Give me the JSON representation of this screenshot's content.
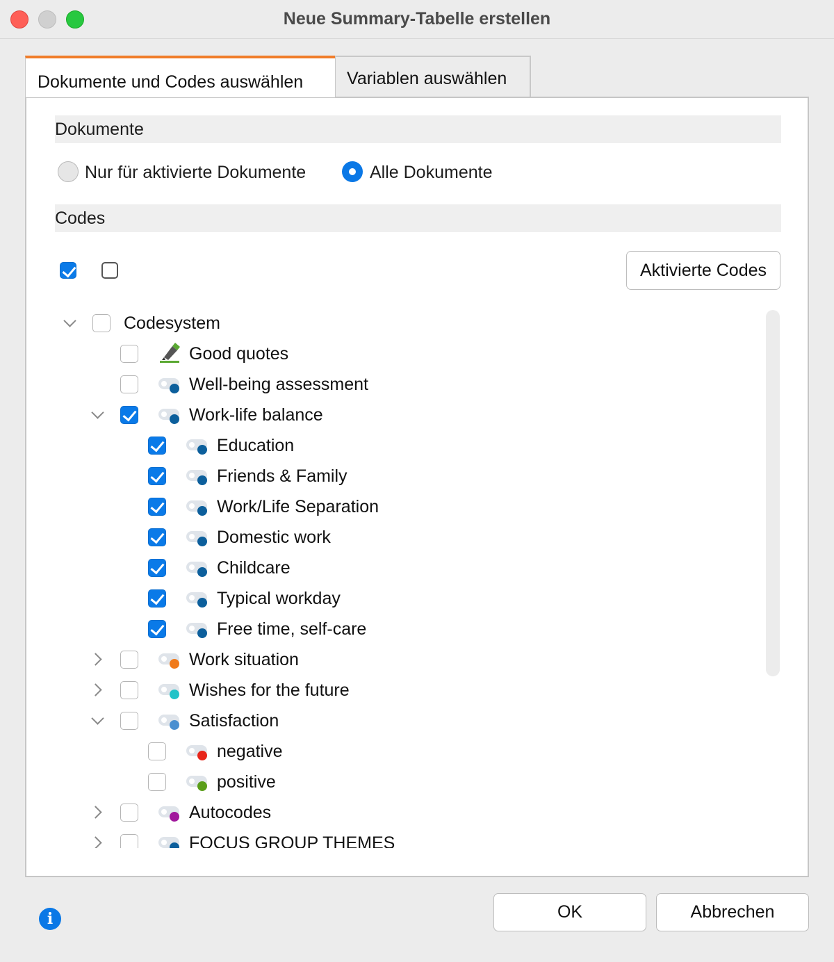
{
  "window": {
    "title": "Neue Summary-Tabelle erstellen"
  },
  "tabs": [
    {
      "label": "Dokumente und Codes auswählen",
      "active": true
    },
    {
      "label": "Variablen auswählen",
      "active": false
    }
  ],
  "documents": {
    "heading": "Dokumente",
    "options": [
      {
        "label": "Nur für aktivierte Dokumente",
        "selected": false
      },
      {
        "label": "Alle Dokumente",
        "selected": true
      }
    ]
  },
  "codes": {
    "heading": "Codes",
    "activated_button": "Aktivierte Codes"
  },
  "tree": [
    {
      "label": "Codesystem",
      "level": 0,
      "expander": "down",
      "checked": false,
      "icon": "none",
      "color": ""
    },
    {
      "label": "Good quotes",
      "level": 1,
      "expander": "none",
      "checked": false,
      "icon": "highlighter-icon",
      "color": "#5aa832"
    },
    {
      "label": "Well-being assessment",
      "level": 1,
      "expander": "none",
      "checked": false,
      "icon": "code-icon",
      "color": "#0c5f9c"
    },
    {
      "label": "Work-life balance",
      "level": 1,
      "expander": "down",
      "checked": true,
      "icon": "code-icon",
      "color": "#0c5f9c"
    },
    {
      "label": "Education",
      "level": 2,
      "expander": "none",
      "checked": true,
      "icon": "code-icon",
      "color": "#0c5f9c"
    },
    {
      "label": "Friends & Family",
      "level": 2,
      "expander": "none",
      "checked": true,
      "icon": "code-icon",
      "color": "#0c5f9c"
    },
    {
      "label": "Work/Life Separation",
      "level": 2,
      "expander": "none",
      "checked": true,
      "icon": "code-icon",
      "color": "#0c5f9c"
    },
    {
      "label": "Domestic work",
      "level": 2,
      "expander": "none",
      "checked": true,
      "icon": "code-icon",
      "color": "#0c5f9c"
    },
    {
      "label": "Childcare",
      "level": 2,
      "expander": "none",
      "checked": true,
      "icon": "code-icon",
      "color": "#0c5f9c"
    },
    {
      "label": "Typical workday",
      "level": 2,
      "expander": "none",
      "checked": true,
      "icon": "code-icon",
      "color": "#0c5f9c"
    },
    {
      "label": "Free time, self-care",
      "level": 2,
      "expander": "none",
      "checked": true,
      "icon": "code-icon",
      "color": "#0c5f9c"
    },
    {
      "label": "Work situation",
      "level": 1,
      "expander": "right",
      "checked": false,
      "icon": "code-icon",
      "color": "#f07a1a"
    },
    {
      "label": "Wishes for the future",
      "level": 1,
      "expander": "right",
      "checked": false,
      "icon": "code-icon",
      "color": "#22c3c8"
    },
    {
      "label": "Satisfaction",
      "level": 1,
      "expander": "down",
      "checked": false,
      "icon": "code-icon",
      "color": "#4a8fd0"
    },
    {
      "label": "negative",
      "level": 2,
      "expander": "none",
      "checked": false,
      "icon": "code-icon",
      "color": "#e8261a"
    },
    {
      "label": "positive",
      "level": 2,
      "expander": "none",
      "checked": false,
      "icon": "code-icon",
      "color": "#5a9e1a"
    },
    {
      "label": "Autocodes",
      "level": 1,
      "expander": "right",
      "checked": false,
      "icon": "code-icon",
      "color": "#a0169c"
    },
    {
      "label": "FOCUS GROUP THEMES",
      "level": 1,
      "expander": "right",
      "checked": false,
      "icon": "code-icon",
      "color": "#0c5f9c"
    }
  ],
  "footer": {
    "ok": "OK",
    "cancel": "Abbrechen",
    "info_icon": "info-icon"
  }
}
